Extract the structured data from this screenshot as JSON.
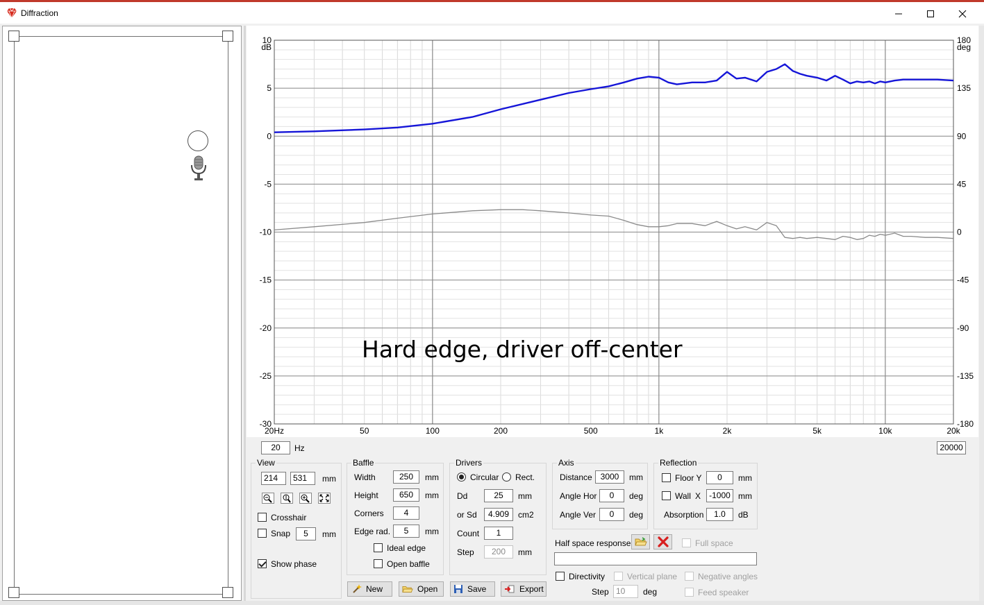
{
  "window": {
    "title": "Diffraction",
    "accent_color": "#c0392b",
    "icons": {
      "app": "diamond-app-icon",
      "minimize": "minimize-icon",
      "maximize": "maximize-icon",
      "close": "close-icon"
    }
  },
  "chart_data": {
    "type": "line",
    "annotation": "Hard edge, driver off-center",
    "x_scale": "log",
    "xlim": [
      20,
      20000
    ],
    "x_ticks": [
      {
        "v": 20,
        "label": "20Hz"
      },
      {
        "v": 50,
        "label": "50"
      },
      {
        "v": 100,
        "label": "100"
      },
      {
        "v": 200,
        "label": "200"
      },
      {
        "v": 500,
        "label": "500"
      },
      {
        "v": 1000,
        "label": "1k"
      },
      {
        "v": 2000,
        "label": "2k"
      },
      {
        "v": 5000,
        "label": "5k"
      },
      {
        "v": 10000,
        "label": "10k"
      },
      {
        "v": 20000,
        "label": "20k"
      }
    ],
    "y_left": {
      "unit": "dB",
      "lim": [
        -30,
        10
      ],
      "ticks": [
        10,
        5,
        0,
        -5,
        -10,
        -15,
        -20,
        -25,
        -30
      ]
    },
    "y_right": {
      "unit": "deg",
      "lim": [
        -180,
        180
      ],
      "ticks": [
        180,
        135,
        90,
        45,
        0,
        -45,
        -90,
        -135,
        -180
      ]
    },
    "grid": true,
    "series": [
      {
        "role": "magnitude",
        "axis": "left",
        "color": "#1515d8",
        "x": [
          20,
          30,
          50,
          70,
          100,
          150,
          200,
          300,
          400,
          500,
          600,
          700,
          800,
          900,
          1000,
          1100,
          1200,
          1400,
          1600,
          1800,
          2000,
          2200,
          2400,
          2700,
          3000,
          3300,
          3600,
          3900,
          4200,
          4500,
          5000,
          5500,
          6000,
          6500,
          7000,
          7500,
          8000,
          8500,
          9000,
          9500,
          10000,
          11000,
          12000,
          13000,
          15000,
          17000,
          20000
        ],
        "y": [
          0.4,
          0.5,
          0.7,
          0.9,
          1.3,
          2.0,
          2.8,
          3.8,
          4.5,
          4.9,
          5.2,
          5.6,
          6.0,
          6.2,
          6.1,
          5.6,
          5.4,
          5.6,
          5.6,
          5.8,
          6.7,
          6.0,
          6.1,
          5.7,
          6.7,
          7.0,
          7.5,
          6.8,
          6.5,
          6.3,
          6.1,
          5.8,
          6.3,
          5.9,
          5.5,
          5.7,
          5.6,
          5.7,
          5.5,
          5.7,
          5.6,
          5.8,
          5.9,
          5.9,
          5.9,
          5.9,
          5.8
        ]
      },
      {
        "role": "phase",
        "axis": "right",
        "color": "#8a8a8a",
        "x": [
          20,
          30,
          50,
          70,
          100,
          150,
          200,
          250,
          300,
          400,
          500,
          600,
          700,
          800,
          900,
          1000,
          1100,
          1200,
          1400,
          1600,
          1800,
          2000,
          2200,
          2400,
          2700,
          3000,
          3300,
          3600,
          3900,
          4200,
          4500,
          5000,
          5500,
          6000,
          6500,
          7000,
          7500,
          8000,
          8500,
          9000,
          9500,
          10000,
          11000,
          12000,
          13000,
          15000,
          17000,
          20000
        ],
        "y": [
          2,
          5,
          9,
          13,
          17,
          20,
          21,
          21,
          20,
          18,
          16,
          15,
          11,
          7,
          5,
          5,
          6,
          8,
          8,
          6,
          10,
          6,
          3,
          5,
          2,
          9,
          6,
          -5,
          -6,
          -5,
          -6,
          -5,
          -6,
          -7,
          -4,
          -5,
          -7,
          -6,
          -3,
          -4,
          -2,
          -3,
          -1,
          -4,
          -4,
          -5,
          -5,
          -6
        ]
      }
    ]
  },
  "freq_range": {
    "min": "20",
    "min_unit": "Hz",
    "max": "20000"
  },
  "view": {
    "title": "View",
    "x": "214",
    "y": "531",
    "unit": "mm",
    "zoom_icons": [
      "zoom-out-icon",
      "zoom-height-icon",
      "zoom-in-icon",
      "fit-view-icon"
    ],
    "crosshair_label": "Crosshair",
    "crosshair": false,
    "snap_label": "Snap",
    "snap": false,
    "snap_value": "5",
    "snap_unit": "mm",
    "show_phase_label": "Show phase",
    "show_phase": true
  },
  "baffle": {
    "title": "Baffle",
    "width_label": "Width",
    "width": "250",
    "width_unit": "mm",
    "height_label": "Height",
    "height": "650",
    "height_unit": "mm",
    "corners_label": "Corners",
    "corners": "4",
    "edge_label": "Edge rad.",
    "edge": "5",
    "edge_unit": "mm",
    "ideal_edge_label": "Ideal edge",
    "ideal_edge": false,
    "open_baffle_label": "Open baffle",
    "open_baffle": false
  },
  "drivers": {
    "title": "Drivers",
    "circular_label": "Circular",
    "rect_label": "Rect.",
    "shape": "circular",
    "dd_label": "Dd",
    "dd": "25",
    "dd_unit": "mm",
    "sd_label": "or Sd",
    "sd": "4.909",
    "sd_unit": "cm2",
    "count_label": "Count",
    "count": "1",
    "step_label": "Step",
    "step": "200",
    "step_unit": "mm"
  },
  "axis": {
    "title": "Axis",
    "distance_label": "Distance",
    "distance": "3000",
    "distance_unit": "mm",
    "angle_hor_label": "Angle Hor",
    "angle_hor": "0",
    "angle_hor_unit": "deg",
    "angle_ver_label": "Angle Ver",
    "angle_ver": "0",
    "angle_ver_unit": "deg"
  },
  "reflection": {
    "title": "Reflection",
    "floor_label": "Floor Y",
    "floor": false,
    "floor_value": "0",
    "floor_unit": "mm",
    "wall_label": "Wall",
    "wall_axis": "X",
    "wall": false,
    "wall_value": "-1000",
    "wall_unit": "mm",
    "absorption_label": "Absorption",
    "absorption": "1.0",
    "absorption_unit": "dB"
  },
  "half_space": {
    "label": "Half space response",
    "file": "",
    "full_space_label": "Full space",
    "full_space": false,
    "icons": [
      "open-folder-icon",
      "delete-x-icon"
    ]
  },
  "directivity": {
    "label": "Directivity",
    "checked": false,
    "vertical_plane_label": "Vertical plane",
    "negative_angles_label": "Negative angles",
    "step_label": "Step",
    "step": "10",
    "step_unit": "deg",
    "feed_speaker_label": "Feed speaker"
  },
  "buttons": {
    "new": "New",
    "open": "Open",
    "save": "Save",
    "export": "Export"
  }
}
